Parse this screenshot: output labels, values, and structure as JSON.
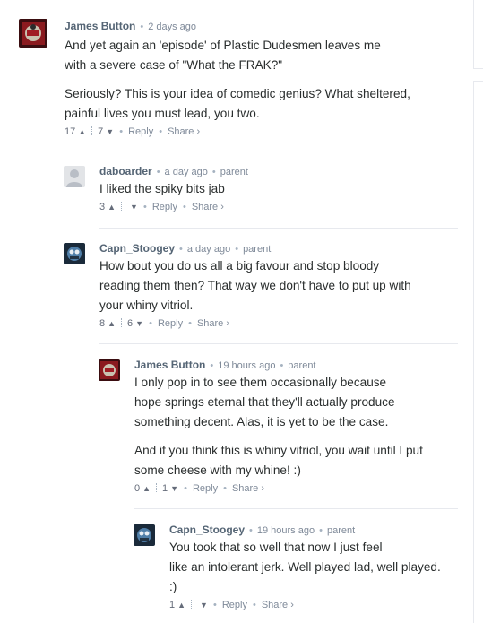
{
  "comments": [
    {
      "author": "James Button",
      "time": "2 days ago",
      "parent": "",
      "paragraphs": [
        "And yet again an 'episode' of Plastic Dudesmen leaves me\nwith a severe case of \"What the FRAK?\"",
        "Seriously? This is your idea of comedic genius? What sheltered,\npainful lives you must lead, you two."
      ],
      "up": "17",
      "down": "7"
    },
    {
      "author": "daboarder",
      "time": "a day ago",
      "parent": "parent",
      "paragraphs": [
        "I liked the spiky bits jab"
      ],
      "up": "3",
      "down": ""
    },
    {
      "author": "Capn_Stoogey",
      "time": "a day ago",
      "parent": "parent",
      "paragraphs": [
        "How bout you do us all a big favour and stop bloody\nreading them then? That way we don't have to put up with\nyour whiny vitriol."
      ],
      "up": "8",
      "down": "6"
    },
    {
      "author": "James Button",
      "time": "19 hours ago",
      "parent": "parent",
      "paragraphs": [
        "I only pop in to see them occasionally because\nhope springs eternal that they'll actually produce\nsomething decent. Alas, it is yet to be the case.",
        "And if you think this is whiny vitriol, you wait until I put\nsome cheese with my whine! :)"
      ],
      "up": "0",
      "down": "1"
    },
    {
      "author": "Capn_Stoogey",
      "time": "19 hours ago",
      "parent": "parent",
      "paragraphs": [
        "You took that so well that now I just feel\nlike an intolerant jerk. Well played lad, well played.\n:)"
      ],
      "up": "1",
      "down": ""
    }
  ],
  "actions": {
    "reply": "Reply",
    "share": "Share ›"
  },
  "icons": {
    "upvote": "chevron-up-icon",
    "downvote": "chevron-down-icon"
  },
  "colors": {
    "author": "#556575",
    "meta": "#7f8a99",
    "text": "#2a2e2e",
    "divider": "#e7e9ee"
  }
}
